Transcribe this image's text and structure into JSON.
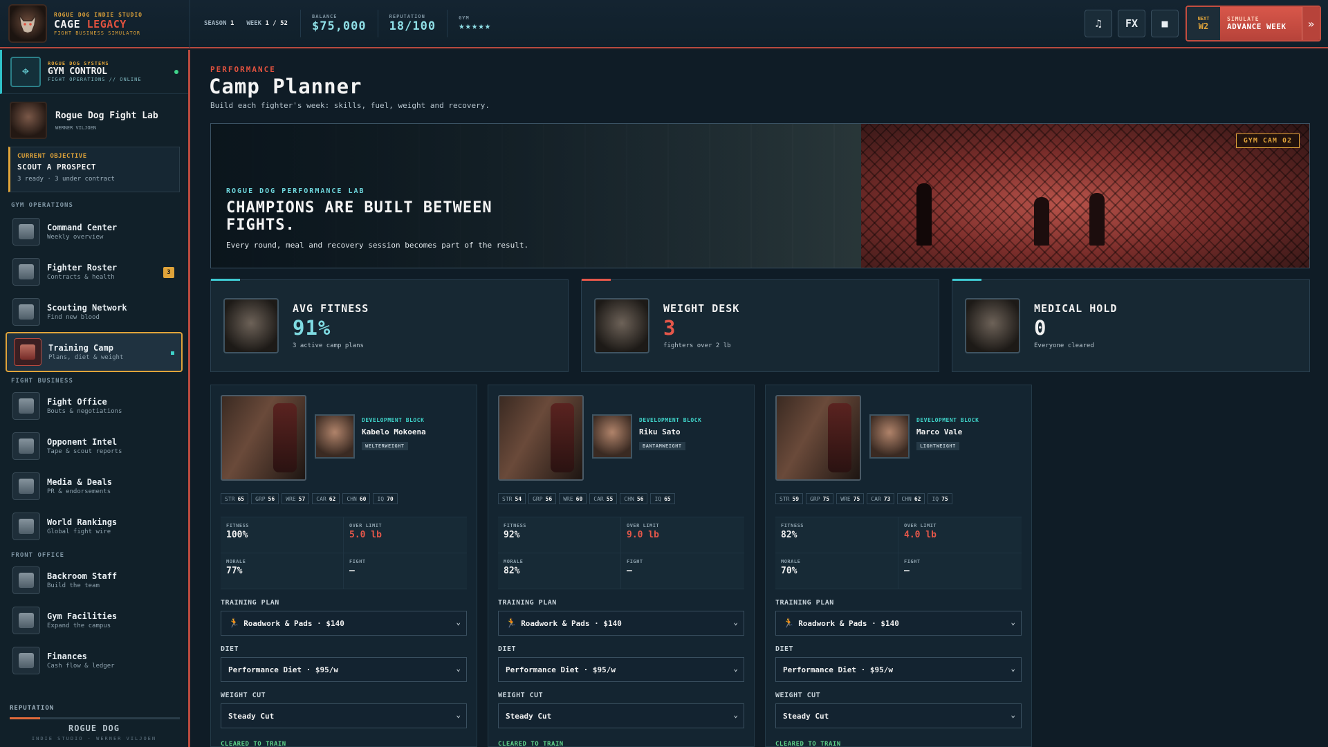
{
  "topbar": {
    "studio": "ROGUE DOG INDIE STUDIO",
    "title_main": "CAGE",
    "title_accent": "LEGACY",
    "subtitle": "FIGHT BUSINESS SIMULATOR",
    "season_label": "SEASON",
    "season_value": "1",
    "week_label": "WEEK",
    "week_value": "1 / 52",
    "balance_label": "BALANCE",
    "balance_value": "$75,000",
    "reputation_label": "REPUTATION",
    "reputation_value": "18/100",
    "gym_label": "GYM",
    "gym_stars": "★★★★★",
    "music_icon": "♫",
    "fx_label": "FX",
    "stop_icon": "■",
    "next_label": "NEXT",
    "next_value": "W2",
    "simulate_label": "SIMULATE",
    "advance_label": "ADVANCE WEEK",
    "advance_arrow": "»"
  },
  "sidebar": {
    "system": {
      "kicker": "ROGUE DOG SYSTEMS",
      "title": "GYM CONTROL",
      "status": "FIGHT OPERATIONS // ONLINE"
    },
    "gym": {
      "name": "Rogue Dog Fight Lab",
      "owner": "WERNER VILJOEN"
    },
    "objective": {
      "label": "CURRENT OBJECTIVE",
      "title": "SCOUT A PROSPECT",
      "status": "3 ready · 3 under contract"
    },
    "sections": {
      "gym_operations": "GYM OPERATIONS",
      "fight_business": "FIGHT BUSINESS",
      "front_office": "FRONT OFFICE"
    },
    "items": [
      {
        "title": "Command Center",
        "sub": "Weekly overview"
      },
      {
        "title": "Fighter Roster",
        "sub": "Contracts & health",
        "badge": "3"
      },
      {
        "title": "Scouting Network",
        "sub": "Find new blood"
      },
      {
        "title": "Training Camp",
        "sub": "Plans, diet & weight"
      },
      {
        "title": "Fight Office",
        "sub": "Bouts & negotiations"
      },
      {
        "title": "Opponent Intel",
        "sub": "Tape & scout reports"
      },
      {
        "title": "Media & Deals",
        "sub": "PR & endorsements"
      },
      {
        "title": "World Rankings",
        "sub": "Global fight wire"
      },
      {
        "title": "Backroom Staff",
        "sub": "Build the team"
      },
      {
        "title": "Gym Facilities",
        "sub": "Expand the campus"
      },
      {
        "title": "Finances",
        "sub": "Cash flow & ledger"
      }
    ],
    "reputation_label": "REPUTATION",
    "reputation_fraction": 0.18,
    "footer_name": "ROGUE DOG",
    "footer_sub": "INDIE STUDIO · WERNER VILJOEN"
  },
  "main": {
    "kicker": "PERFORMANCE",
    "title": "Camp Planner",
    "subtitle": "Build each fighter's week: skills, fuel, weight and recovery.",
    "hero": {
      "kicker": "ROGUE DOG PERFORMANCE LAB",
      "headline": "CHAMPIONS ARE BUILT BETWEEN FIGHTS.",
      "sub": "Every round, meal and recovery session becomes part of the result.",
      "tag": "GYM CAM 02"
    },
    "kpis": [
      {
        "label": "AVG FITNESS",
        "value": "91%",
        "sub": "3 active camp plans",
        "color": "#7fdbe2"
      },
      {
        "label": "WEIGHT DESK",
        "value": "3",
        "sub": "fighters over 2 lb",
        "color": "#e5574a"
      },
      {
        "label": "MEDICAL HOLD",
        "value": "0",
        "sub": "Everyone cleared",
        "color": "#f1f1f1"
      }
    ],
    "fighter_labels": {
      "block": "DEVELOPMENT BLOCK",
      "fitness": "FITNESS",
      "over_limit": "OVER LIMIT",
      "morale": "MORALE",
      "fight": "FIGHT",
      "training_plan": "TRAINING PLAN",
      "diet": "DIET",
      "weight_cut": "WEIGHT CUT",
      "cleared": "CLEARED TO TRAIN"
    },
    "fighters": [
      {
        "name": "Kabelo Mokoena",
        "class": "WELTERWEIGHT",
        "attrs": [
          [
            "STR",
            "65"
          ],
          [
            "GRP",
            "56"
          ],
          [
            "WRE",
            "57"
          ],
          [
            "CAR",
            "62"
          ],
          [
            "CHN",
            "60"
          ],
          [
            "IQ",
            "70"
          ]
        ],
        "fitness": "100%",
        "over_limit": "5.0 lb",
        "morale": "77%",
        "fight": "—",
        "plan": "Roadwork & Pads · $140",
        "diet": "Performance Diet · $95/w",
        "cut": "Steady Cut"
      },
      {
        "name": "Riku Sato",
        "class": "BANTAMWEIGHT",
        "attrs": [
          [
            "STR",
            "54"
          ],
          [
            "GRP",
            "56"
          ],
          [
            "WRE",
            "60"
          ],
          [
            "CAR",
            "55"
          ],
          [
            "CHN",
            "56"
          ],
          [
            "IQ",
            "65"
          ]
        ],
        "fitness": "92%",
        "over_limit": "9.0 lb",
        "morale": "82%",
        "fight": "—",
        "plan": "Roadwork & Pads · $140",
        "diet": "Performance Diet · $95/w",
        "cut": "Steady Cut"
      },
      {
        "name": "Marco Vale",
        "class": "LIGHTWEIGHT",
        "attrs": [
          [
            "STR",
            "59"
          ],
          [
            "GRP",
            "75"
          ],
          [
            "WRE",
            "75"
          ],
          [
            "CAR",
            "73"
          ],
          [
            "CHN",
            "62"
          ],
          [
            "IQ",
            "75"
          ]
        ],
        "fitness": "82%",
        "over_limit": "4.0 lb",
        "morale": "70%",
        "fight": "—",
        "plan": "Roadwork & Pads · $140",
        "diet": "Performance Diet · $95/w",
        "cut": "Steady Cut"
      }
    ]
  }
}
